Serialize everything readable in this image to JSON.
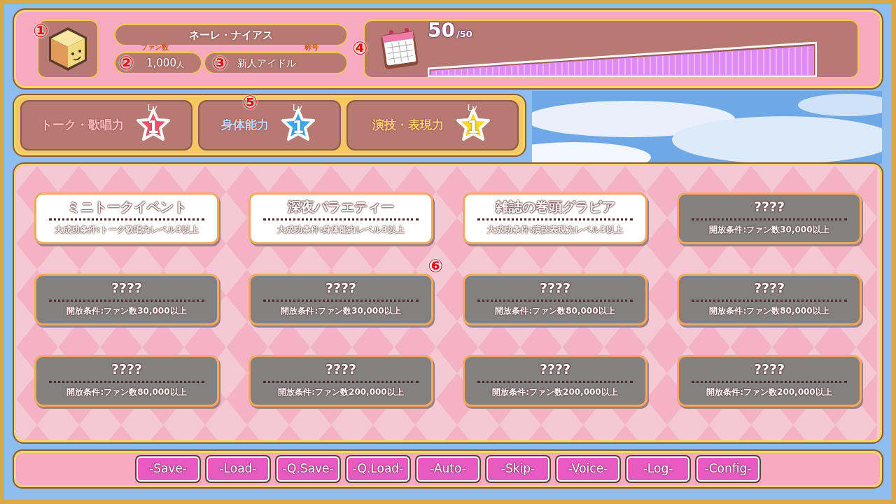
{
  "profile": {
    "avatar_marker": "①",
    "name": "ネーレ・ナイアス",
    "fans": {
      "marker": "②",
      "label": "ファン数",
      "value": "1,000",
      "unit": "人"
    },
    "title": {
      "marker": "③",
      "label": "称号",
      "value": "新人アイドル"
    }
  },
  "stamina": {
    "marker": "④",
    "value": "50",
    "max": "/50",
    "level": 1
  },
  "skills": {
    "marker": "⑤",
    "items": [
      {
        "name": "トーク・歌唱力",
        "lv_label": "Lv",
        "level_text": "1",
        "color": "#f0506a"
      },
      {
        "name": "身体能力",
        "lv_label": "Lv",
        "level_text": "1",
        "color": "#3aa8f0"
      },
      {
        "name": "演技・表現力",
        "lv_label": "Lv",
        "level_text": "1",
        "color": "#f8d820"
      }
    ]
  },
  "events": {
    "marker": "⑥",
    "cards": [
      {
        "kind": "unlocked",
        "title": "ミニトークイベント",
        "condition": "大成功条件:トーク歌唱力レベル3以上"
      },
      {
        "kind": "unlocked",
        "title": "深夜バラエティー",
        "condition": "大成功条件:身体能力レベル3以上"
      },
      {
        "kind": "unlocked",
        "title": "雑誌の巻頭グラビア",
        "condition": "大成功条件:演技表現力レベル3以上"
      },
      {
        "kind": "locked",
        "title": "????",
        "condition": "開放条件:ファン数30,000以上"
      },
      {
        "kind": "locked",
        "title": "????",
        "condition": "開放条件:ファン数30,000以上"
      },
      {
        "kind": "locked",
        "title": "????",
        "condition": "開放条件:ファン数30,000以上"
      },
      {
        "kind": "locked",
        "title": "????",
        "condition": "開放条件:ファン数80,000以上"
      },
      {
        "kind": "locked",
        "title": "????",
        "condition": "開放条件:ファン数80,000以上"
      },
      {
        "kind": "locked",
        "title": "????",
        "condition": "開放条件:ファン数80,000以上"
      },
      {
        "kind": "locked",
        "title": "????",
        "condition": "開放条件:ファン数200,000以上"
      },
      {
        "kind": "locked",
        "title": "????",
        "condition": "開放条件:ファン数200,000以上"
      },
      {
        "kind": "locked",
        "title": "????",
        "condition": "開放条件:ファン数200,000以上"
      }
    ]
  },
  "menu": [
    "-Save-",
    "-Load-",
    "-Q.Save-",
    "-Q.Load-",
    "-Auto-",
    "-Skip-",
    "-Voice-",
    "-Log-",
    "-Config-"
  ]
}
